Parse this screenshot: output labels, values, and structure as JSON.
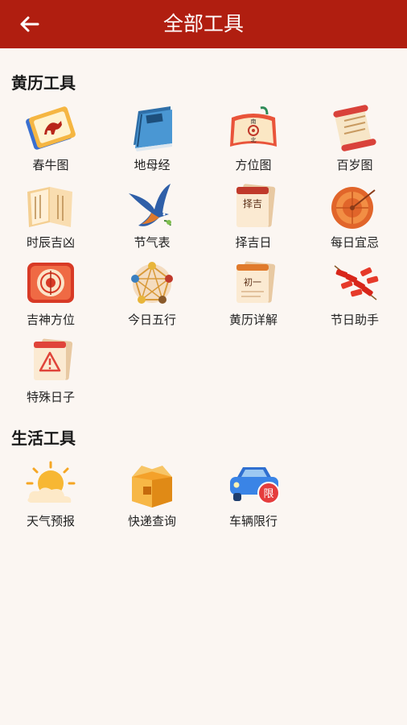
{
  "header": {
    "title": "全部工具"
  },
  "sections": [
    {
      "title": "黄历工具",
      "items": [
        {
          "label": "春牛图",
          "icon": "ox-picture-icon"
        },
        {
          "label": "地母经",
          "icon": "book-icon"
        },
        {
          "label": "方位图",
          "icon": "compass-scroll-icon"
        },
        {
          "label": "百岁图",
          "icon": "scroll-icon"
        },
        {
          "label": "时辰吉凶",
          "icon": "open-book-icon"
        },
        {
          "label": "节气表",
          "icon": "swallow-icon"
        },
        {
          "label": "择吉日",
          "icon": "calendar-icon"
        },
        {
          "label": "每日宜忌",
          "icon": "target-icon"
        },
        {
          "label": "吉神方位",
          "icon": "luopan-icon"
        },
        {
          "label": "今日五行",
          "icon": "five-elements-icon"
        },
        {
          "label": "黄历详解",
          "icon": "almanac-icon"
        },
        {
          "label": "节日助手",
          "icon": "firecracker-icon"
        },
        {
          "label": "特殊日子",
          "icon": "warning-calendar-icon"
        }
      ]
    },
    {
      "title": "生活工具",
      "items": [
        {
          "label": "天气预报",
          "icon": "sun-cloud-icon"
        },
        {
          "label": "快递查询",
          "icon": "package-icon"
        },
        {
          "label": "车辆限行",
          "icon": "car-restriction-icon"
        }
      ]
    }
  ],
  "icon_text": {
    "calendar": "择吉",
    "almanac": "初一",
    "car_badge": "限",
    "compass_top": "南",
    "compass_bottom": "北"
  }
}
